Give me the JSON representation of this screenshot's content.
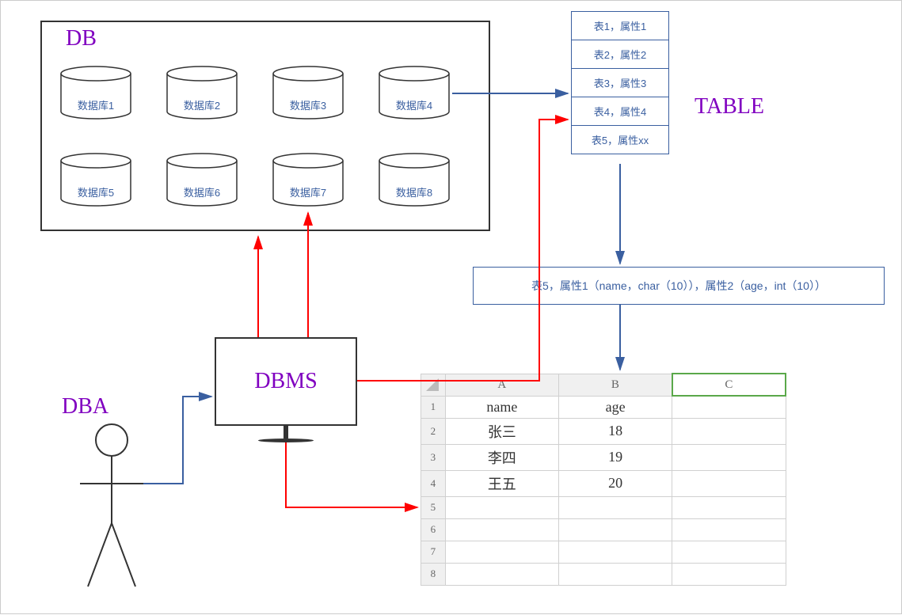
{
  "labels": {
    "db": "DB",
    "table": "TABLE",
    "dba": "DBA",
    "dbms": "DBMS"
  },
  "databases": [
    "数据库1",
    "数据库2",
    "数据库3",
    "数据库4",
    "数据库5",
    "数据库6",
    "数据库7",
    "数据库8"
  ],
  "tables": [
    "表1，属性1",
    "表2，属性2",
    "表3，属性3",
    "表4，属性4",
    "表5，属性xx"
  ],
  "schema": "表5，属性1（name，char（10）），属性2（age，int（10））",
  "spreadsheet": {
    "columns": [
      "A",
      "B",
      "C"
    ],
    "headers": [
      "name",
      "age",
      ""
    ],
    "rows": [
      [
        "张三",
        "18",
        ""
      ],
      [
        "李四",
        "19",
        ""
      ],
      [
        "王五",
        "20",
        ""
      ],
      [
        "",
        "",
        ""
      ],
      [
        "",
        "",
        ""
      ],
      [
        "",
        "",
        ""
      ],
      [
        "",
        "",
        ""
      ]
    ]
  },
  "colors": {
    "purple": "#8000c0",
    "blue": "#3a5fa0",
    "red": "#ff0000",
    "green": "#5aa84a"
  }
}
